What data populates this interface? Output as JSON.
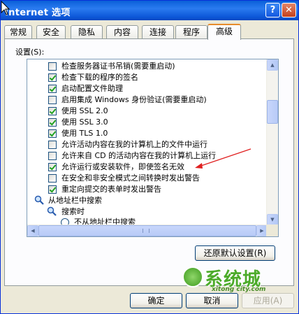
{
  "window": {
    "title": "Internet 选项",
    "help_glyph": "?",
    "close_glyph": "✕"
  },
  "tabs": [
    {
      "label": "常规",
      "active": false
    },
    {
      "label": "安全",
      "active": false
    },
    {
      "label": "隐私",
      "active": false
    },
    {
      "label": "内容",
      "active": false
    },
    {
      "label": "连接",
      "active": false
    },
    {
      "label": "程序",
      "active": false
    },
    {
      "label": "高级",
      "active": true
    }
  ],
  "settings_label": "设置(S):",
  "settings_items": [
    {
      "type": "checkbox",
      "checked": false,
      "label": "检查服务器证书吊销(需要重启动)"
    },
    {
      "type": "checkbox",
      "checked": true,
      "label": "检查下载的程序的签名"
    },
    {
      "type": "checkbox",
      "checked": true,
      "label": "启动配置文件助理"
    },
    {
      "type": "checkbox",
      "checked": false,
      "label": "启用集成 Windows 身份验证(需要重启动)"
    },
    {
      "type": "checkbox",
      "checked": true,
      "label": "使用 SSL 2.0"
    },
    {
      "type": "checkbox",
      "checked": true,
      "label": "使用 SSL 3.0"
    },
    {
      "type": "checkbox",
      "checked": true,
      "label": "使用 TLS 1.0"
    },
    {
      "type": "checkbox",
      "checked": false,
      "label": "允许活动内容在我的计算机上的文件中运行"
    },
    {
      "type": "checkbox",
      "checked": false,
      "label": "允许来自 CD 的活动内容在我的计算机上运行"
    },
    {
      "type": "checkbox",
      "checked": true,
      "label": "允许运行或安装软件，即使签名无效"
    },
    {
      "type": "checkbox",
      "checked": false,
      "label": "在安全和非安全模式之间转换时发出警告"
    },
    {
      "type": "checkbox",
      "checked": true,
      "label": "重定向提交的表单时发出警告"
    },
    {
      "type": "category",
      "label": "从地址栏中搜索"
    },
    {
      "type": "subcategory",
      "label": "搜索时"
    },
    {
      "type": "radio",
      "checked": false,
      "label": "不从地址栏中搜索"
    }
  ],
  "restore_defaults_label": "还原默认设置(R)",
  "buttons": {
    "ok": "确定",
    "cancel": "取消",
    "apply": "应用(A)"
  },
  "watermark": {
    "text": "系统城",
    "url": "xitong city.com"
  },
  "colors": {
    "titlebar": "#0a5fd8",
    "annotation_arrow": "#e02020",
    "active_tab_accent": "#e68b2c",
    "check": "#21a121"
  }
}
